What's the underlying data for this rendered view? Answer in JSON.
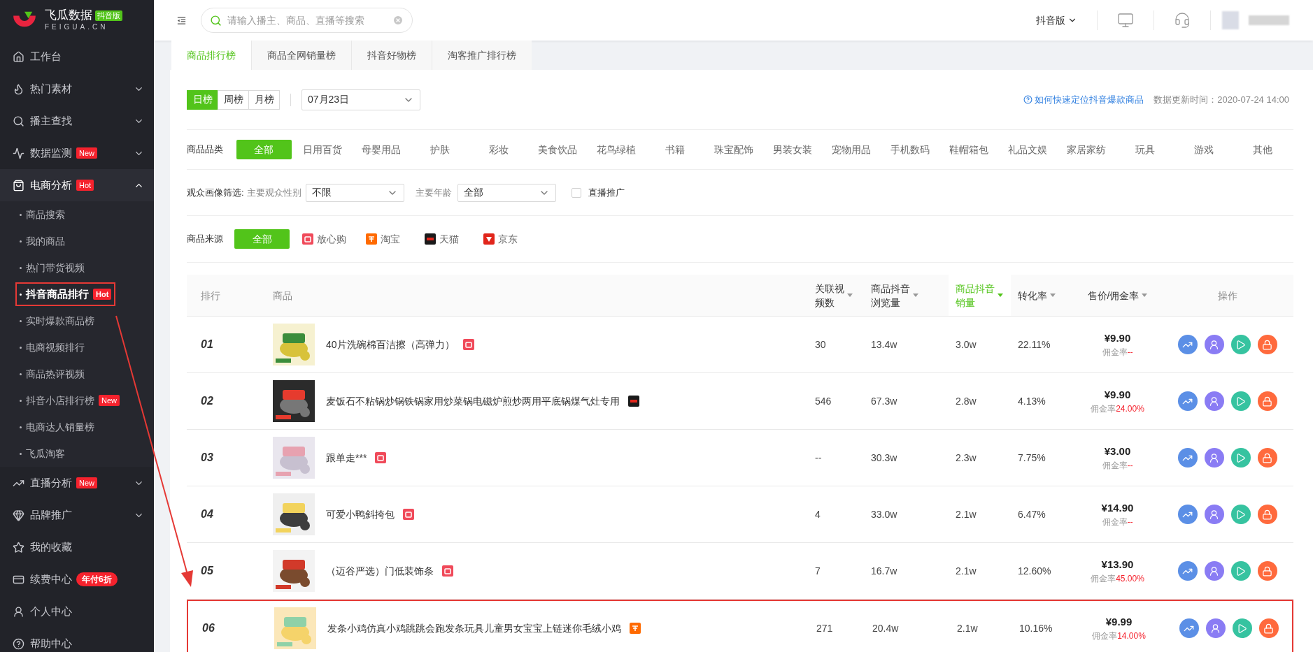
{
  "sidebar": {
    "logo": {
      "name": "飞瓜数据",
      "edition": "抖音版",
      "domain": "FEIGUA.CN"
    },
    "items": [
      {
        "label": "工作台",
        "selected": false
      },
      {
        "label": "热门素材",
        "selected": false,
        "expanded": false
      },
      {
        "label": "播主查找",
        "selected": false,
        "expanded": false
      },
      {
        "label": "数据监测",
        "selected": false,
        "expanded": false,
        "badge": {
          "text": "New",
          "kind": "tag"
        }
      },
      {
        "label": "电商分析",
        "selected": false,
        "expanded": true,
        "badge": {
          "text": "Hot",
          "kind": "tag"
        },
        "children": [
          {
            "label": "商品搜索",
            "selected": false,
            "annotated": false
          },
          {
            "label": "我的商品",
            "selected": false,
            "annotated": false
          },
          {
            "label": "热门带货视频",
            "selected": false,
            "annotated": false
          },
          {
            "label": "抖音商品排行",
            "selected": true,
            "annotated": true,
            "badge": {
              "text": "Hot",
              "kind": "tag"
            }
          },
          {
            "label": "实时爆款商品榜",
            "selected": false,
            "annotated": false
          },
          {
            "label": "电商视频排行",
            "selected": false,
            "annotated": false
          },
          {
            "label": "商品热评视频",
            "selected": false,
            "annotated": false
          },
          {
            "label": "抖音小店排行榜",
            "selected": false,
            "annotated": false,
            "badge": {
              "text": "New",
              "kind": "tag"
            }
          },
          {
            "label": "电商达人销量榜",
            "selected": false,
            "annotated": false
          },
          {
            "label": "飞瓜淘客",
            "selected": false,
            "annotated": false
          }
        ]
      },
      {
        "label": "直播分析",
        "selected": false,
        "expanded": false,
        "badge": {
          "text": "New",
          "kind": "tag"
        }
      },
      {
        "label": "品牌推广",
        "selected": false,
        "expanded": false
      },
      {
        "label": "我的收藏",
        "selected": false
      },
      {
        "label": "续费中心",
        "selected": false,
        "badge": {
          "text": "年付6折",
          "kind": "pill"
        }
      },
      {
        "label": "个人中心",
        "selected": false
      },
      {
        "label": "帮助中心",
        "selected": false
      }
    ]
  },
  "topbar": {
    "search": {
      "placeholder": "请输入播主、商品、直播等搜索"
    },
    "edition_menu": "抖音版"
  },
  "tabs": [
    {
      "label": "商品排行榜",
      "selected": true
    },
    {
      "label": "商品全网销量榜",
      "selected": false
    },
    {
      "label": "抖音好物榜",
      "selected": false
    },
    {
      "label": "淘客推广排行榜",
      "selected": false
    }
  ],
  "period_tabs": [
    {
      "label": "日榜",
      "selected": true
    },
    {
      "label": "周榜",
      "selected": false
    },
    {
      "label": "月榜",
      "selected": false
    }
  ],
  "date_select": {
    "value": "07月23日"
  },
  "help_link": "如何快速定位抖音爆款商品",
  "update_time": "数据更新时间：2020-07-24 14:00",
  "category_filter": {
    "label": "商品品类",
    "options": [
      {
        "label": "全部",
        "selected": true
      },
      {
        "label": "日用百货",
        "selected": false
      },
      {
        "label": "母婴用品",
        "selected": false
      },
      {
        "label": "护肤",
        "selected": false
      },
      {
        "label": "彩妆",
        "selected": false
      },
      {
        "label": "美食饮品",
        "selected": false
      },
      {
        "label": "花鸟绿植",
        "selected": false
      },
      {
        "label": "书籍",
        "selected": false
      },
      {
        "label": "珠宝配饰",
        "selected": false
      },
      {
        "label": "男装女装",
        "selected": false
      },
      {
        "label": "宠物用品",
        "selected": false
      },
      {
        "label": "手机数码",
        "selected": false
      },
      {
        "label": "鞋帽箱包",
        "selected": false
      },
      {
        "label": "礼品文娱",
        "selected": false
      },
      {
        "label": "家居家纺",
        "selected": false
      },
      {
        "label": "玩具",
        "selected": false
      },
      {
        "label": "游戏",
        "selected": false
      },
      {
        "label": "其他",
        "selected": false
      }
    ]
  },
  "audience_filter": {
    "label": "观众画像筛选:",
    "gender_label": "主要观众性别",
    "gender_value": "不限",
    "age_label": "主要年龄",
    "age_value": "全部",
    "live_promo": {
      "label": "直播推广",
      "checked": false
    }
  },
  "source_filter": {
    "label": "商品来源",
    "options": [
      {
        "label": "全部",
        "selected": true,
        "kind": "all"
      },
      {
        "label": "放心购",
        "selected": false,
        "kind": "fangxingou"
      },
      {
        "label": "淘宝",
        "selected": false,
        "kind": "taobao"
      },
      {
        "label": "天猫",
        "selected": false,
        "kind": "tmall"
      },
      {
        "label": "京东",
        "selected": false,
        "kind": "jd"
      }
    ]
  },
  "table": {
    "columns": [
      {
        "label": "排行",
        "sortable": false,
        "selected": false
      },
      {
        "label": "商品",
        "sortable": false,
        "selected": false
      },
      {
        "label": "关联视频数",
        "sortable": true,
        "selected": false
      },
      {
        "label": "商品抖音浏览量",
        "sortable": true,
        "selected": false
      },
      {
        "label": "商品抖音销量",
        "sortable": true,
        "selected": true
      },
      {
        "label": "转化率",
        "sortable": true,
        "selected": false
      },
      {
        "label": "售价/佣金率",
        "sortable": true,
        "selected": false
      },
      {
        "label": "操作",
        "sortable": false,
        "selected": false
      }
    ],
    "rows": [
      {
        "rank": "01",
        "name": "40片洗碗棉百洁擦（高弹力）",
        "store": {
          "kind": "fangxingou"
        },
        "videos": "30",
        "views": "13.4w",
        "sales": "3.0w",
        "conversion": "22.11%",
        "price": "¥9.90",
        "commission_label": "佣金率",
        "commission": "--",
        "annotated": false
      },
      {
        "rank": "02",
        "name": "麦饭石不粘锅炒锅铁锅家用炒菜锅电磁炉煎炒两用平底锅煤气灶专用",
        "store": {
          "kind": "tmall"
        },
        "videos": "546",
        "views": "67.3w",
        "sales": "2.8w",
        "conversion": "4.13%",
        "price": "¥9.90",
        "commission_label": "佣金率",
        "commission": "24.00%",
        "annotated": false
      },
      {
        "rank": "03",
        "name": "跟单走***",
        "store": {
          "kind": "fangxingou"
        },
        "videos": "--",
        "views": "30.3w",
        "sales": "2.3w",
        "conversion": "7.75%",
        "price": "¥3.00",
        "commission_label": "佣金率",
        "commission": "--",
        "annotated": false
      },
      {
        "rank": "04",
        "name": "可爱小鸭斜挎包",
        "store": {
          "kind": "fangxingou"
        },
        "videos": "4",
        "views": "33.0w",
        "sales": "2.1w",
        "conversion": "6.47%",
        "price": "¥14.90",
        "commission_label": "佣金率",
        "commission": "--",
        "annotated": false
      },
      {
        "rank": "05",
        "name": "（迈谷严选）门低装饰条",
        "store": {
          "kind": "fangxingou"
        },
        "videos": "7",
        "views": "16.7w",
        "sales": "2.1w",
        "conversion": "12.60%",
        "price": "¥13.90",
        "commission_label": "佣金率",
        "commission": "45.00%",
        "annotated": false
      },
      {
        "rank": "06",
        "name": "发条小鸡仿真小鸡跳跳会跑发条玩具儿童男女宝宝上链迷你毛绒小鸡",
        "store": {
          "kind": "taobao"
        },
        "videos": "271",
        "views": "20.4w",
        "sales": "2.1w",
        "conversion": "10.16%",
        "price": "¥9.99",
        "commission_label": "佣金率",
        "commission": "14.00%",
        "annotated": true
      }
    ]
  }
}
